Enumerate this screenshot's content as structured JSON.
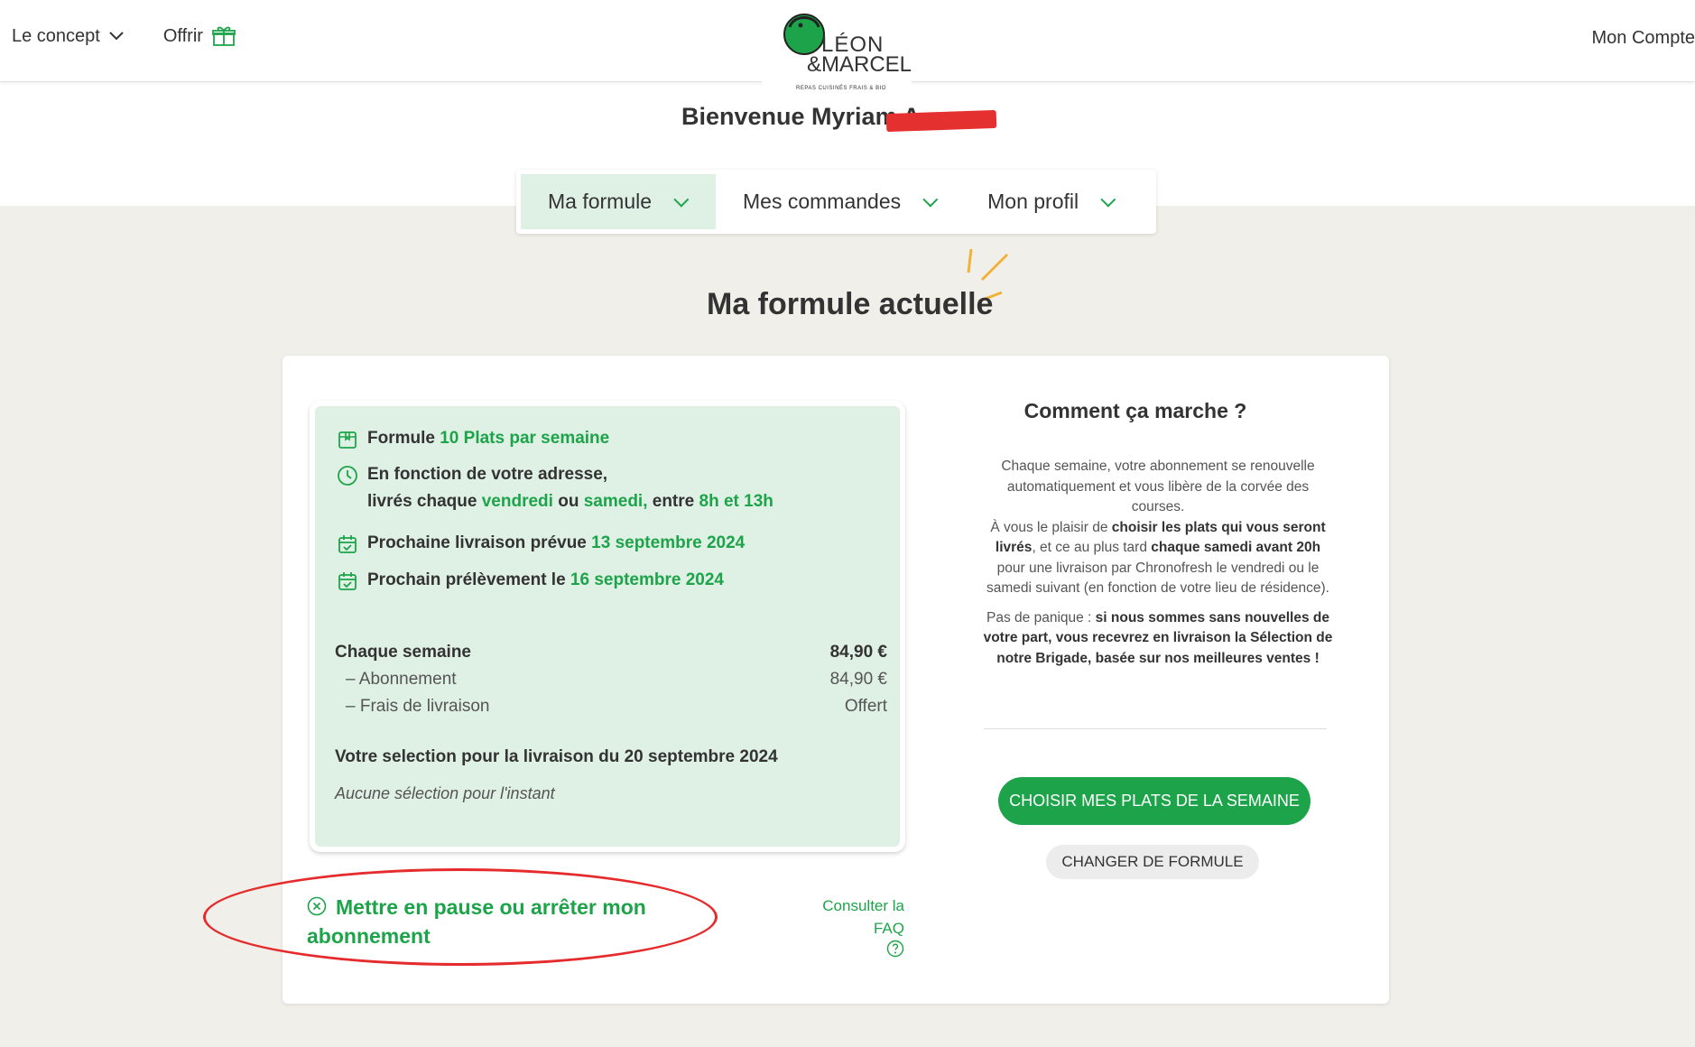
{
  "header": {
    "nav_concept": "Le concept",
    "nav_offer": "Offrir",
    "account": "Mon Compte",
    "logo_leon": "LÉON",
    "logo_marcel": "&MARCEL",
    "logo_tagline": "REPAS CUISINÉS FRAIS & BIO",
    "brand_color": "#1da44a"
  },
  "welcome": "Bienvenue Myriam A",
  "tabs": [
    {
      "label": "Ma formule",
      "active": true
    },
    {
      "label": "Mes commandes",
      "active": false
    },
    {
      "label": "Mon profil",
      "active": false
    }
  ],
  "section_title": "Ma formule actuelle",
  "formula": {
    "formula_label": "Formule ",
    "formula_value": "10 Plats par semaine",
    "delivery_line1": "En fonction de votre adresse,",
    "delivery_prefix": "livrés chaque ",
    "delivery_day1": "vendredi",
    "delivery_or": " ou ",
    "delivery_day2": "samedi,",
    "delivery_between": " entre ",
    "delivery_hours": "8h et 13h",
    "next_delivery_label": "Prochaine livraison prévue ",
    "next_delivery_date": "13 septembre 2024",
    "next_payment_label": "Prochain prélèvement le ",
    "next_payment_date": "16 septembre 2024"
  },
  "pricing": {
    "weekly_label": "Chaque semaine",
    "weekly_value": "84,90 €",
    "subscription_label": "– Abonnement",
    "subscription_value": "84,90 €",
    "delivery_label": "– Frais de livraison",
    "delivery_value": "Offert"
  },
  "selection": {
    "title": "Votre selection pour la livraison du 20 septembre 2024",
    "empty": "Aucune sélection pour l'instant"
  },
  "pause_link": "Mettre en pause ou arrêter mon abonnement",
  "faq_link": "Consulter la FAQ",
  "how": {
    "title": "Comment ça marche ?",
    "p1_a": "Chaque semaine, votre abonnement se renouvelle automatiquement et vous libère de la corvée des courses.",
    "p1_b": "À vous le plaisir de ",
    "p1_c": "choisir les plats qui vous seront livrés",
    "p1_d": ", et ce au plus tard ",
    "p1_e": "chaque samedi avant 20h",
    "p1_f": " pour une livraison par Chronofresh le vendredi ou le samedi suivant (en fonction de votre lieu de résidence).",
    "p2_a": "Pas de panique : ",
    "p2_b": "si nous sommes sans nouvelles de votre part, vous recevrez en livraison la Sélection de notre Brigade, basée sur nos meilleures ventes !"
  },
  "buttons": {
    "choose": "CHOISIR MES PLATS DE LA SEMAINE",
    "change": "CHANGER DE FORMULE"
  }
}
